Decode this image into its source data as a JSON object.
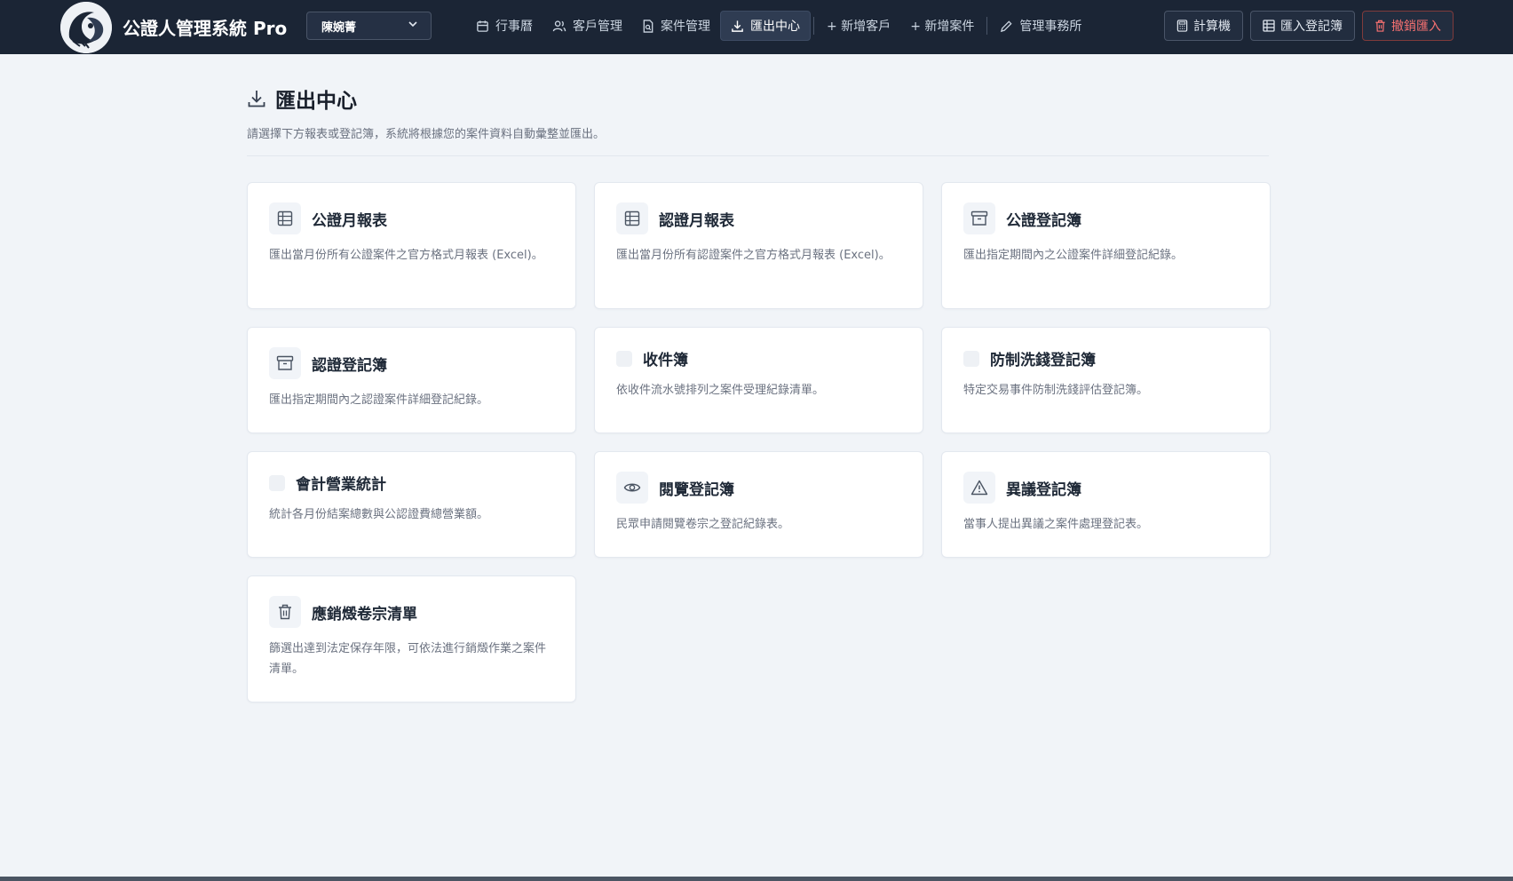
{
  "app": {
    "title": "公證人管理系統 Pro",
    "user": "陳婉菁"
  },
  "nav": [
    {
      "label": "行事曆",
      "icon": "calendar-icon",
      "active": false
    },
    {
      "label": "客戶管理",
      "icon": "users-icon",
      "active": false
    },
    {
      "label": "案件管理",
      "icon": "file-search-icon",
      "active": false
    },
    {
      "label": "匯出中心",
      "icon": "download-icon",
      "active": true
    },
    {
      "label": "+ 新增客戶",
      "icon": "",
      "active": false
    },
    {
      "label": "+ 新增案件",
      "icon": "",
      "active": false
    },
    {
      "label": "管理事務所",
      "icon": "pencil-icon",
      "active": false
    }
  ],
  "tools": {
    "calculator": "計算機",
    "import_registry": "匯入登記簿",
    "undo_import": "撤銷匯入"
  },
  "page": {
    "title": "匯出中心",
    "subtitle": "請選擇下方報表或登記簿，系統將根據您的案件資料自動彙整並匯出。"
  },
  "cards": [
    {
      "title": "公證月報表",
      "desc": "匯出當月份所有公證案件之官方格式月報表 (Excel)。",
      "icon": "table-icon"
    },
    {
      "title": "認證月報表",
      "desc": "匯出當月份所有認證案件之官方格式月報表 (Excel)。",
      "icon": "table-icon"
    },
    {
      "title": "公證登記簿",
      "desc": "匯出指定期間內之公證案件詳細登記紀錄。",
      "icon": "archive-icon"
    },
    {
      "title": "認證登記簿",
      "desc": "匯出指定期間內之認證案件詳細登記紀錄。",
      "icon": "archive-icon"
    },
    {
      "title": "收件簿",
      "desc": "依收件流水號排列之案件受理紀錄清單。",
      "icon": "blank-icon"
    },
    {
      "title": "防制洗錢登記簿",
      "desc": "特定交易事件防制洗錢評估登記簿。",
      "icon": "blank-icon"
    },
    {
      "title": "會計營業統計",
      "desc": "統計各月份結案總數與公認證費總營業額。",
      "icon": "blank-icon"
    },
    {
      "title": "閱覽登記簿",
      "desc": "民眾申請閱覽卷宗之登記紀錄表。",
      "icon": "eye-icon"
    },
    {
      "title": "異議登記簿",
      "desc": "當事人提出異議之案件處理登記表。",
      "icon": "warning-icon"
    },
    {
      "title": "應銷燬卷宗清單",
      "desc": "篩選出達到法定保存年限，可依法進行銷燬作業之案件清單。",
      "icon": "trash-icon"
    }
  ]
}
